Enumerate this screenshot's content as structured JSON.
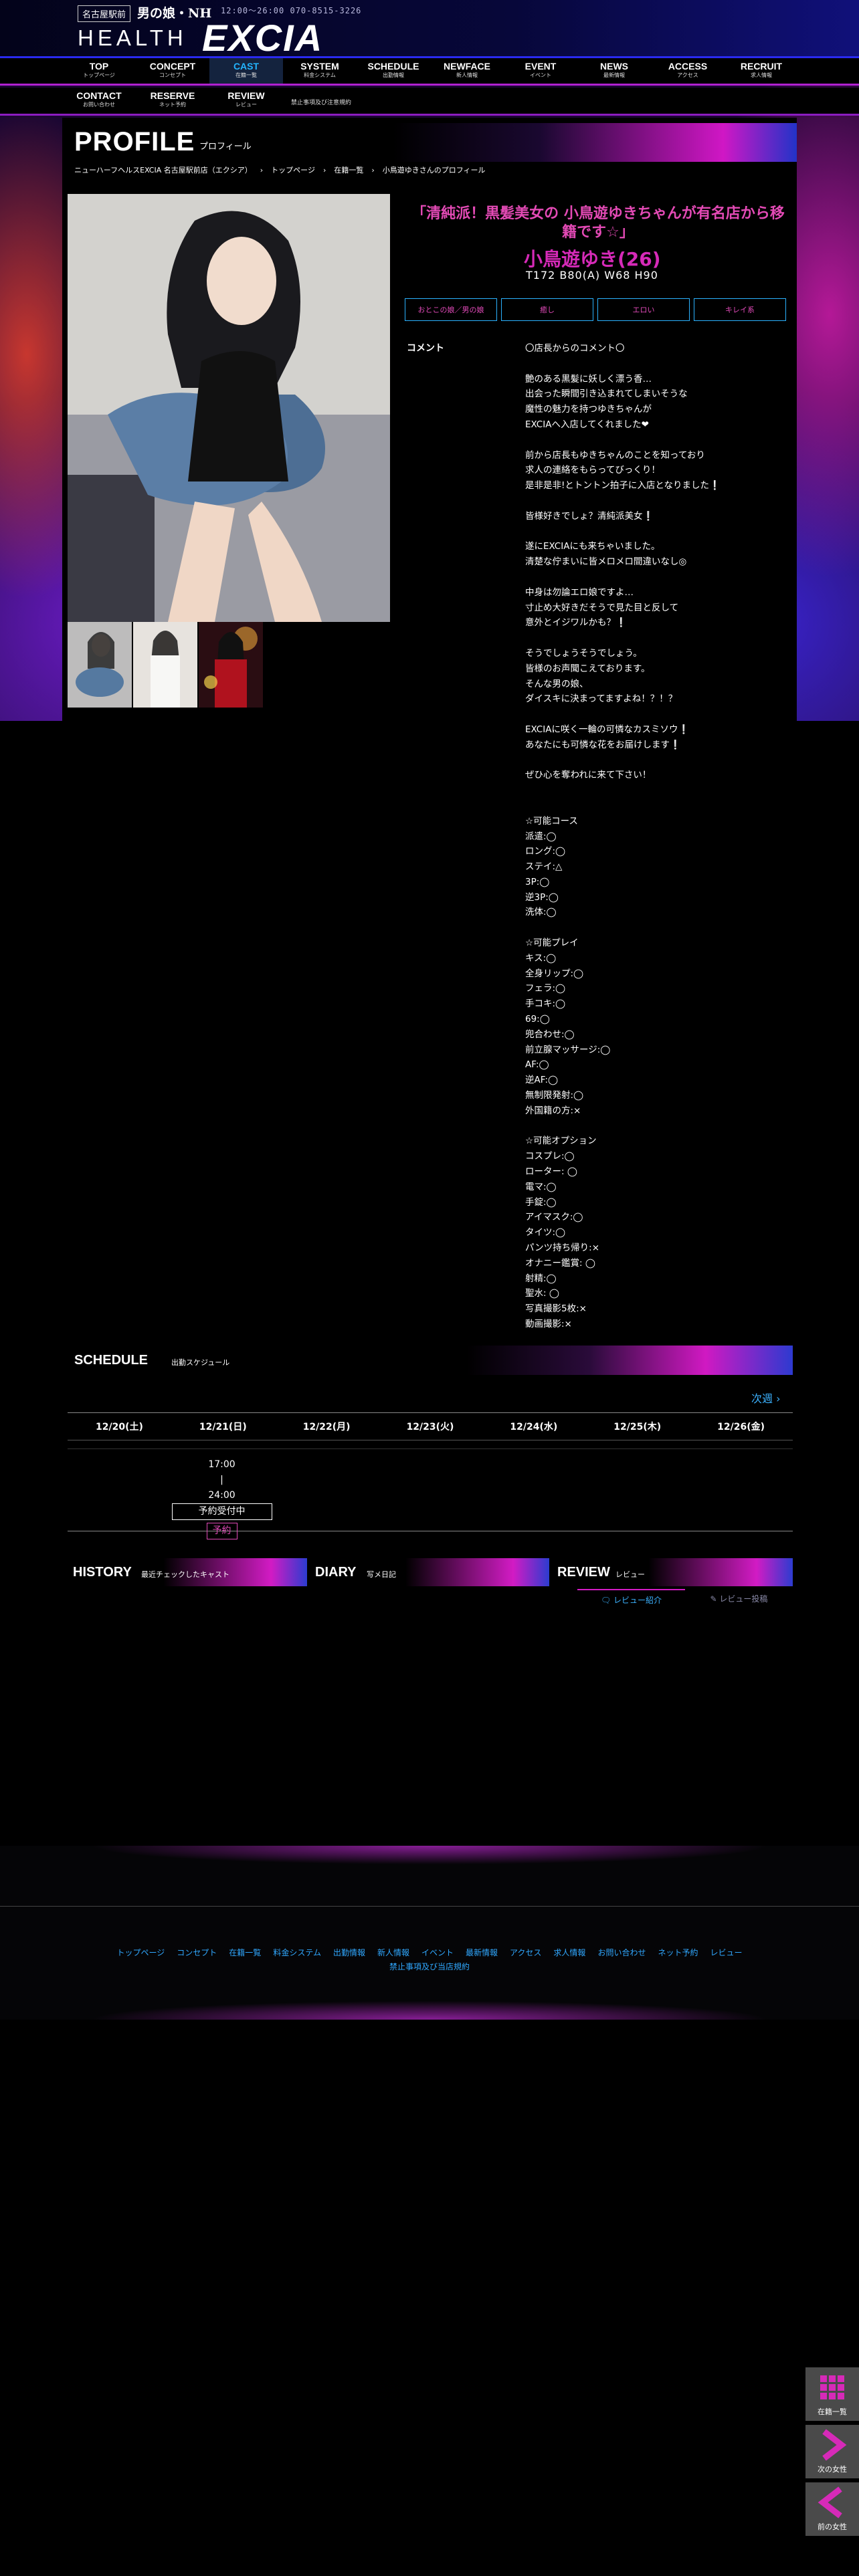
{
  "header": {
    "area_badge": "名古屋駅前",
    "tagline": "男の娘・NH",
    "hours": "12:00～26:00  070-8515-3226",
    "logo_text": "HEALTH",
    "logo_brand": "EXCIA"
  },
  "nav_main": [
    {
      "en": "TOP",
      "jp": "トップページ"
    },
    {
      "en": "CONCEPT",
      "jp": "コンセプト"
    },
    {
      "en": "CAST",
      "jp": "在籍一覧"
    },
    {
      "en": "SYSTEM",
      "jp": "料金システム"
    },
    {
      "en": "SCHEDULE",
      "jp": "出勤情報"
    },
    {
      "en": "NEWFACE",
      "jp": "新人情報"
    },
    {
      "en": "EVENT",
      "jp": "イベント"
    },
    {
      "en": "NEWS",
      "jp": "最新情報"
    },
    {
      "en": "ACCESS",
      "jp": "アクセス"
    },
    {
      "en": "RECRUIT",
      "jp": "求人情報"
    }
  ],
  "nav_sub": [
    {
      "en": "CONTACT",
      "jp": "お問い合わせ"
    },
    {
      "en": "RESERVE",
      "jp": "ネット予約"
    },
    {
      "en": "REVIEW",
      "jp": "レビュー"
    }
  ],
  "nav_sub_note": "禁止事項及び注意規約",
  "profile": {
    "title": "PROFILE",
    "subtitle": "プロフィール",
    "breadcrumb": [
      "ニューハーフヘルスEXCIA 名古屋駅前店（エクシア）",
      "›",
      "トップページ",
      "›",
      "在籍一覧",
      "›",
      "小鳥遊ゆきさんのプロフィール"
    ],
    "catch": "「清純派！黒髪美女の 小鳥遊ゆきちゃんが有名店から移籍です☆」",
    "name": "小鳥遊ゆき(26)",
    "stats": "T172 B80(A) W68 H90",
    "tags": [
      "おとこの娘／男の娘",
      "癒し",
      "エロい",
      "キレイ系"
    ],
    "comment_label": "コメント",
    "comment": "〇店長からのコメント〇\n\n艶のある黒髪に妖しく漂う香…\n出会った瞬間引き込まれてしまいそうな\n魔性の魅力を持つゆきちゃんが\nEXCIAへ入店してくれました❤\n\n前から店長もゆきちゃんのことを知っており\n求人の連絡をもらってびっくり！\n是非是非!とトントン拍子に入店となりました❕\n\n皆様好きでしょ？清純派美女❕\n\n遂にEXCIAにも来ちゃいました。\n清楚な佇まいに皆メロメロ間違いなし◎\n\n中身は勿論エロ娘ですよ…\n寸止め大好きだそうで見た目と反して\n意外とイジワルかも？❕\n\nそうでしょうそうでしょう。\n皆様のお声聞こえております。\nそんな男の娘、\nダイスキに決まってますよね！？！？\n\nEXCIAに咲く一輪の可憐なカスミソウ❕\nあなたにも可憐な花をお届けします❕\n\nぜひ心を奪われに来て下さい！\n\n\n☆可能コース\n派遣:◯\nロング:◯\nステイ:△\n3P:◯\n逆3P:◯\n洗体:◯\n\n☆可能プレイ\nキス:◯\n全身リップ:◯\nフェラ:◯\n手コキ:◯\n69:◯\n兜合わせ:◯\n前立腺マッサージ:◯\nAF:◯\n逆AF:◯\n無制限発射:◯\n外国籍の方:×\n\n☆可能オプション\nコスプレ:◯\nローター: ◯\n電マ:◯\n手錠:◯\nアイマスク:◯\nタイツ:◯\nパンツ持ち帰り:×\nオナニー鑑賞: ◯\n射精:◯\n聖水: ◯\n写真撮影5枚:×\n動画撮影:×"
  },
  "schedule": {
    "title": "SCHEDULE",
    "subtitle": "出勤スケジュール",
    "next_week": "次週 ›",
    "dates": [
      "12/20(土)",
      "12/21(日)",
      "12/22(月)",
      "12/23(火)",
      "12/24(水)",
      "12/25(木)",
      "12/26(金)"
    ],
    "slot_start": "17:00",
    "slot_sep": "|",
    "slot_end": "24:00",
    "status": "予約受付中",
    "reserve": "予約"
  },
  "bottom": {
    "history_title": "HISTORY",
    "history_sub": "最近チェックしたキャスト",
    "diary_title": "DIARY",
    "diary_sub": "写メ日記",
    "review_title": "REVIEW",
    "review_sub": "レビュー",
    "review_tab1": "レビュー紹介",
    "review_tab2": "レビュー投稿"
  },
  "footer": {
    "links": [
      "トップページ",
      "コンセプト",
      "在籍一覧",
      "料金システム",
      "出勤情報",
      "新人情報",
      "イベント",
      "最新情報",
      "アクセス",
      "求人情報",
      "お問い合わせ",
      "ネット予約",
      "レビュー"
    ],
    "rules": "禁止事項及び当店規約"
  },
  "side": {
    "list": "在籍一覧",
    "next": "次の女性",
    "prev": "前の女性"
  },
  "colors": {
    "accent_pink": "#d62ab8",
    "accent_blue": "#2bb2ff"
  }
}
